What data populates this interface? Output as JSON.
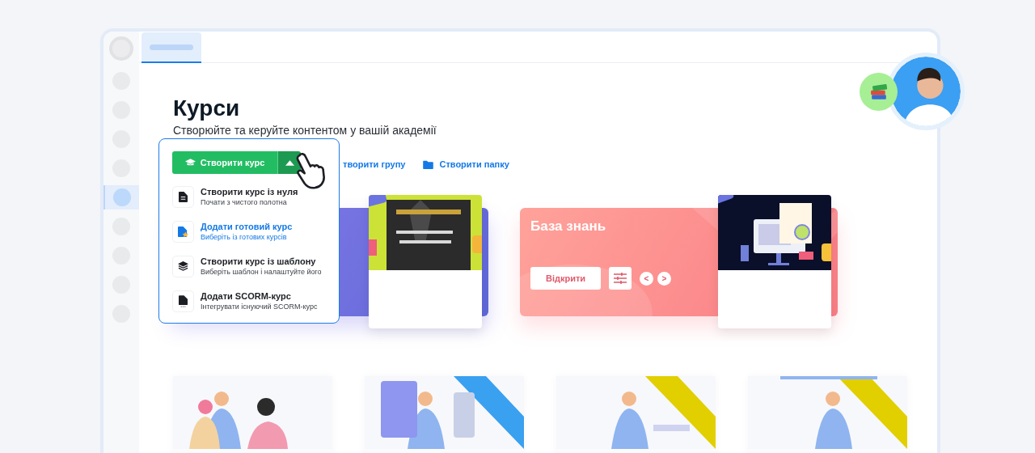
{
  "page": {
    "title": "Курси",
    "subtitle": "Створюйте та керуйте контентом у вашій академії"
  },
  "actions": [
    {
      "label": "творити групу",
      "kind": "group"
    },
    {
      "label": "Створити папку",
      "kind": "folder"
    }
  ],
  "create_button": {
    "label": "Створити курс",
    "expanded": true
  },
  "menu": [
    {
      "title": "Створити курс із нуля",
      "hint": "Почати з чистого полотна",
      "kind": "blank",
      "selected": false
    },
    {
      "title": "Додати готовий курс",
      "hint": "Виберіть із готових курсів",
      "kind": "ready",
      "selected": true
    },
    {
      "title": "Створити курс із шаблону",
      "hint": "Виберіть шаблон і налаштуйте його",
      "kind": "template",
      "selected": false
    },
    {
      "title": "Додати SCORM-курс",
      "hint": "Інтегрувати існуючий SCORM-курс",
      "kind": "scorm",
      "selected": false
    }
  ],
  "knowledge_card": {
    "title": "База знань",
    "open_button": "Відкрити",
    "prev": "<",
    "next": ">"
  }
}
